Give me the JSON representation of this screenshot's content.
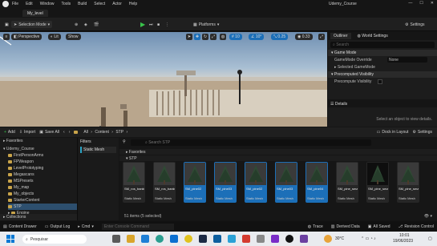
{
  "menubar": {
    "items": [
      "File",
      "Edit",
      "Window",
      "Tools",
      "Build",
      "Select",
      "Actor",
      "Help"
    ],
    "project": "Udemy_Course"
  },
  "level_tab": "My_level",
  "toolbar": {
    "mode": "Selection Mode",
    "platforms": "Platforms",
    "settings": "Settings"
  },
  "viewport": {
    "perspective": "Perspective",
    "lit": "Lit",
    "show": "Show",
    "snap": "10",
    "angle": "10°",
    "scale": "0.25",
    "cam": "0.33"
  },
  "outliner": {
    "tab_outliner": "Outliner",
    "tab_world": "World Settings",
    "search_placeholder": "Search",
    "sections": [
      "Game Mode",
      "Precomputed Visibility"
    ],
    "props": [
      {
        "label": "GameMode Override",
        "value": "None"
      },
      {
        "label": "Selected GameMode",
        "value": ""
      },
      {
        "label": "Precompute Visibility",
        "value": ""
      }
    ]
  },
  "details": {
    "title": "Details",
    "message": "Select an object to view details."
  },
  "content_bar": {
    "add": "Add",
    "import": "Import",
    "save_all": "Save All",
    "path": [
      "All",
      "Content",
      "STP"
    ],
    "dock": "Dock in Layout",
    "settings": "Settings"
  },
  "sources": {
    "favorites": "Favorites",
    "project": "Udemy_Course",
    "folders": [
      "FirstPersonArms",
      "FPWeapon",
      "LevelPrototyping",
      "Megascans",
      "MSPresets",
      "My_map",
      "My_objects",
      "StarterContent",
      "STP"
    ],
    "engine": "Engine",
    "collections": "Collections"
  },
  "filters": {
    "title": "Filters",
    "selected": "Static Mesh"
  },
  "assets": {
    "search_placeholder": "Search STP",
    "sections": [
      "Favorites",
      "STP"
    ],
    "items": [
      {
        "name": "SM_ros_bank02",
        "type": "Static Mesh",
        "selected": false,
        "dark": false
      },
      {
        "name": "SM_ros_bank03",
        "type": "Static Mesh",
        "selected": false,
        "dark": false
      },
      {
        "name": "SM_pine02",
        "type": "Static Mesh",
        "selected": true,
        "dark": false
      },
      {
        "name": "SM_pine03",
        "type": "Static Mesh",
        "selected": true,
        "dark": false
      },
      {
        "name": "SM_pine02",
        "type": "Static Mesh",
        "selected": true,
        "dark": false
      },
      {
        "name": "SM_pine03",
        "type": "Static Mesh",
        "selected": true,
        "dark": false
      },
      {
        "name": "SM_pine04",
        "type": "Static Mesh",
        "selected": true,
        "dark": false
      },
      {
        "name": "SM_pine_small02",
        "type": "Static Mesh",
        "selected": false,
        "dark": false
      },
      {
        "name": "SM_pine_small03",
        "type": "Static Mesh",
        "selected": false,
        "dark": true
      },
      {
        "name": "SM_pine_small03",
        "type": "Static Mesh",
        "selected": false,
        "dark": false
      }
    ],
    "count": "51 items (5 selected)"
  },
  "status": {
    "drawer": "Content Drawer",
    "output": "Output Log",
    "cmd": "Cmd",
    "console_placeholder": "Enter Console Command",
    "trace": "Trace",
    "derived": "Derived Data",
    "saved": "All Saved",
    "revision": "Revision Control"
  },
  "taskbar": {
    "search": "Pesquisar",
    "temp": "30°C",
    "time": "10:01",
    "date": "19/06/2023"
  }
}
